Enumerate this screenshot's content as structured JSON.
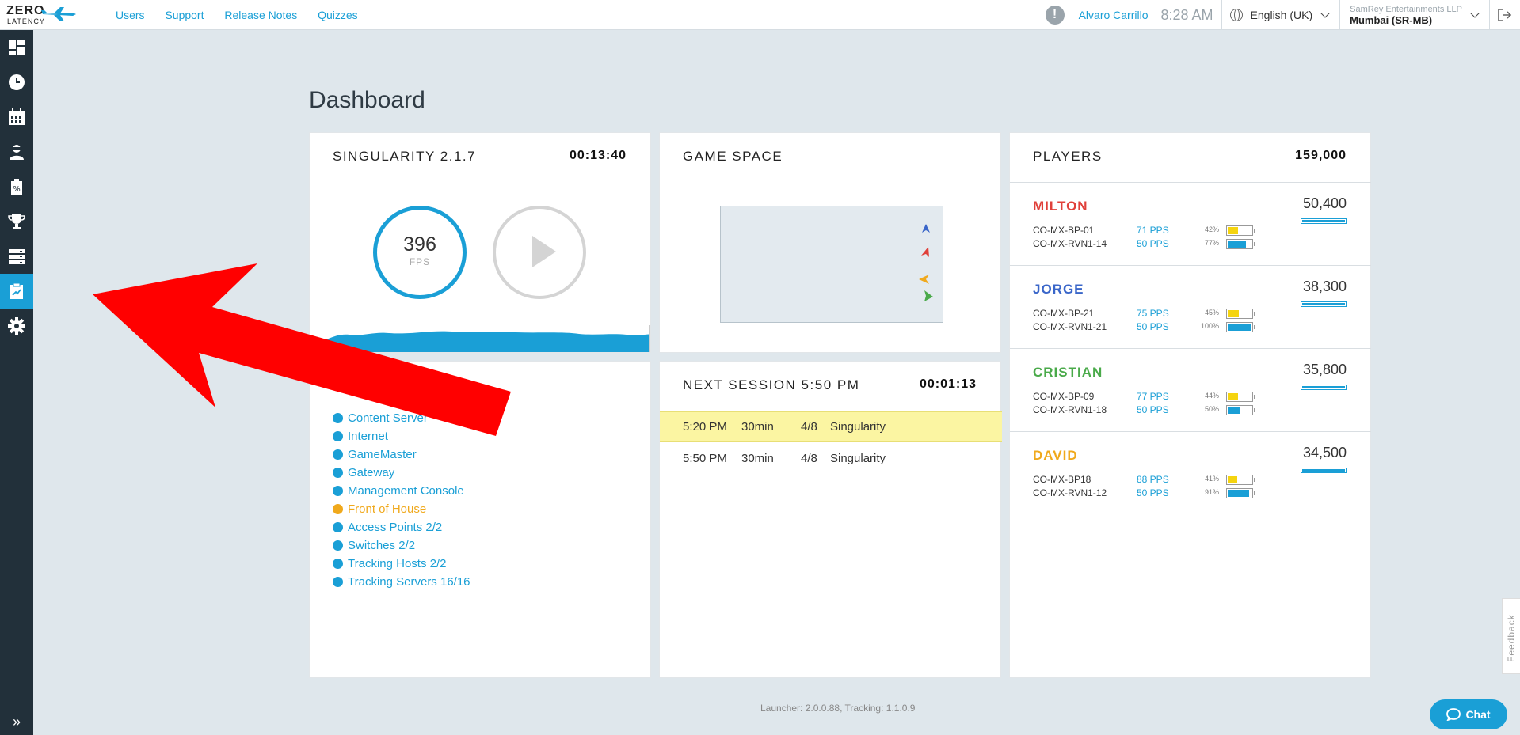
{
  "brand": {
    "line1": "ZERO",
    "line2": "LATENCY"
  },
  "nav": {
    "users": "Users",
    "support": "Support",
    "release_notes": "Release Notes",
    "quizzes": "Quizzes"
  },
  "topbar": {
    "alert": "!",
    "username": "Alvaro Carrillo",
    "time": "8:28 AM",
    "language": "English (UK)",
    "venue_company": "SamRey Entertainments LLP",
    "venue_name": "Mumbai (SR-MB)"
  },
  "sidebar_icons": [
    "dashboard-icon",
    "history-icon",
    "calendar-icon",
    "player-icon",
    "discount-icon",
    "trophy-icon",
    "servers-icon",
    "reports-icon",
    "settings-icon"
  ],
  "page": {
    "title": "Dashboard"
  },
  "singularity": {
    "title": "SINGULARITY 2.1.7",
    "timer": "00:13:40",
    "fps": "396",
    "fps_label": "FPS"
  },
  "game_space": {
    "title": "GAME SPACE"
  },
  "system": {
    "items": [
      {
        "label": "Content Server",
        "status": "ok"
      },
      {
        "label": "Internet",
        "status": "ok"
      },
      {
        "label": "GameMaster",
        "status": "ok"
      },
      {
        "label": "Gateway",
        "status": "ok"
      },
      {
        "label": "Management Console",
        "status": "ok"
      },
      {
        "label": "Front of House",
        "status": "warning"
      },
      {
        "label": "Access Points 2/2",
        "status": "ok"
      },
      {
        "label": "Switches 2/2",
        "status": "ok"
      },
      {
        "label": "Tracking Hosts 2/2",
        "status": "ok"
      },
      {
        "label": "Tracking Servers 16/16",
        "status": "ok"
      }
    ]
  },
  "next_session": {
    "title": "NEXT SESSION 5:50 PM",
    "timer": "00:01:13",
    "rows": [
      {
        "time": "5:20 PM",
        "duration": "30min",
        "players": "4/8",
        "game": "Singularity"
      },
      {
        "time": "5:50 PM",
        "duration": "30min",
        "players": "4/8",
        "game": "Singularity"
      }
    ]
  },
  "players": {
    "title": "PLAYERS",
    "total": "159,000",
    "list": [
      {
        "name": "MILTON",
        "color": "#e0403a",
        "score": "50,400",
        "devices": [
          {
            "id": "CO-MX-BP-01",
            "pps": "71 PPS",
            "battery": "42%",
            "level": 0.42,
            "fill": "#f5d40f"
          },
          {
            "id": "CO-MX-RVN1-14",
            "pps": "50 PPS",
            "battery": "77%",
            "level": 0.77,
            "fill": "#1a9fd6"
          }
        ]
      },
      {
        "name": "JORGE",
        "color": "#3a66c9",
        "score": "38,300",
        "devices": [
          {
            "id": "CO-MX-BP-21",
            "pps": "75 PPS",
            "battery": "45%",
            "level": 0.45,
            "fill": "#f5d40f"
          },
          {
            "id": "CO-MX-RVN1-21",
            "pps": "50 PPS",
            "battery": "100%",
            "level": 1.0,
            "fill": "#1a9fd6"
          }
        ]
      },
      {
        "name": "CRISTIAN",
        "color": "#4aaa4a",
        "score": "35,800",
        "devices": [
          {
            "id": "CO-MX-BP-09",
            "pps": "77 PPS",
            "battery": "44%",
            "level": 0.44,
            "fill": "#f5d40f"
          },
          {
            "id": "CO-MX-RVN1-18",
            "pps": "50 PPS",
            "battery": "50%",
            "level": 0.5,
            "fill": "#1a9fd6"
          }
        ]
      },
      {
        "name": "DAVID",
        "color": "#f0a91c",
        "score": "34,500",
        "devices": [
          {
            "id": "CO-MX-BP18",
            "pps": "88 PPS",
            "battery": "41%",
            "level": 0.41,
            "fill": "#f5d40f"
          },
          {
            "id": "CO-MX-RVN1-12",
            "pps": "50 PPS",
            "battery": "91%",
            "level": 0.91,
            "fill": "#1a9fd6"
          }
        ]
      }
    ]
  },
  "footer": {
    "versions": "Launcher: 2.0.0.88, Tracking: 1.1.0.9"
  },
  "feedback": {
    "label": "Feedback"
  },
  "chat": {
    "label": "Chat"
  }
}
